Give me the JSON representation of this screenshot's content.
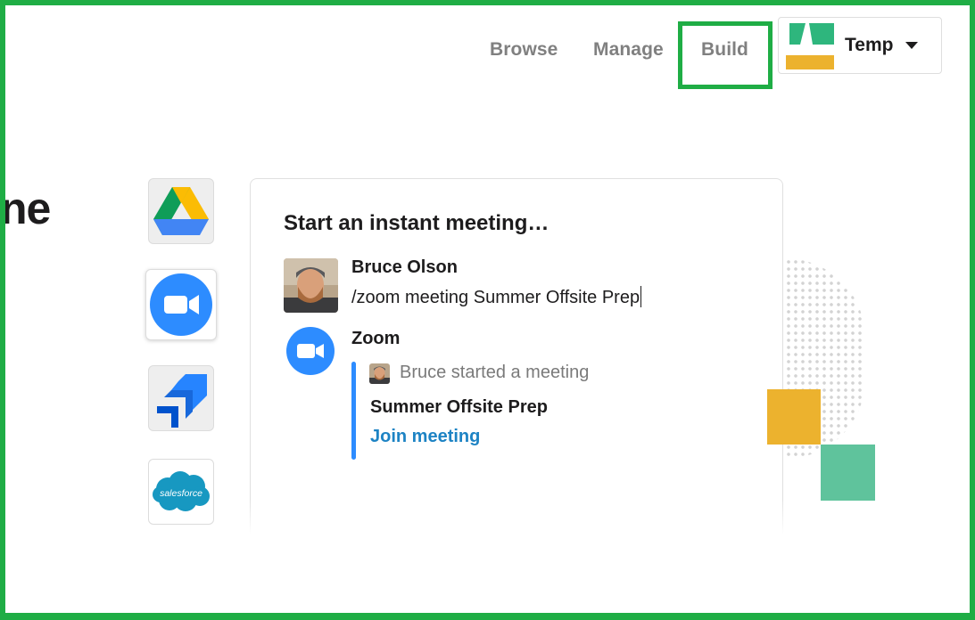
{
  "nav": {
    "browse": "Browse",
    "manage": "Manage",
    "build": "Build"
  },
  "workspace": {
    "name": "Temp",
    "logo_colors": [
      "#2eb67d",
      "#ecb22e"
    ]
  },
  "hero": {
    "fragment": "ne"
  },
  "integrations": [
    {
      "name": "Google Drive",
      "icon": "google-drive-icon"
    },
    {
      "name": "Zoom",
      "icon": "zoom-icon",
      "selected": true
    },
    {
      "name": "Jira",
      "icon": "jira-icon"
    },
    {
      "name": "Salesforce",
      "icon": "salesforce-icon",
      "label": "salesforce"
    }
  ],
  "card": {
    "title": "Start an instant meeting…",
    "message": {
      "author": "Bruce Olson",
      "text": "/zoom meeting Summer Offsite Prep"
    },
    "bot": {
      "name": "Zoom",
      "attachment": {
        "started": "Bruce started a meeting",
        "meeting_title": "Summer Offsite Prep",
        "join_label": "Join meeting"
      }
    }
  },
  "colors": {
    "highlight": "#1fad45",
    "zoom_blue": "#2d8cff",
    "link": "#1d83c4",
    "accent_yellow": "#ecb22e",
    "accent_green": "#5fc39c"
  }
}
